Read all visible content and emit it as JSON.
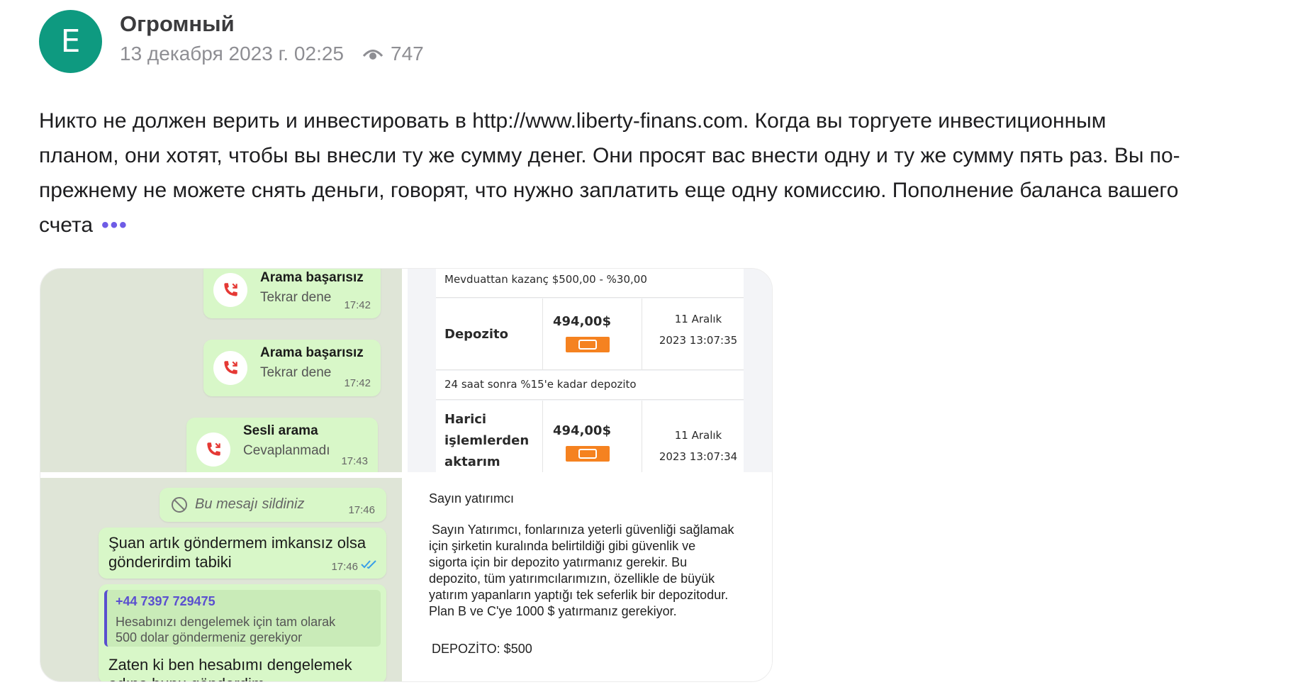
{
  "author": {
    "avatar_letter": "E",
    "avatar_color": "#0e9a80",
    "name": "Огромный"
  },
  "meta": {
    "date": "13 декабря 2023 г. 02:25",
    "views": "747",
    "views_icon": "eye-icon"
  },
  "post": {
    "text": "Никто не должен верить и инвестировать в http://www.liberty-finans.com. Когда вы торгуете инвестиционным планом, они хотят, чтобы вы внесли ту же сумму денег. Они просят вас внести одну и ту же сумму пять раз. Вы по-прежнему не можете снять деньги, говорят, что нужно заплатить еще одну комиссию. Пополнение баланса вашего счета",
    "more": "•••",
    "accent": "#6e5ce6"
  },
  "gallery": {
    "calls": [
      {
        "title": "Arama başarısız",
        "subtitle": "Tekrar dene",
        "time": "17:42"
      },
      {
        "title": "Arama başarısız",
        "subtitle": "Tekrar dene",
        "time": "17:42"
      },
      {
        "title": "Sesli arama",
        "subtitle": "Cevaplanmadı",
        "time": "17:43"
      }
    ],
    "deposits": {
      "header": "Mevduattan kazanç $500,00 - %30,00",
      "row1": {
        "label": "Depozito",
        "amount": "494,00$",
        "date1": "11 Aralık",
        "date2": "2023 13:07:35"
      },
      "note": "24 saat sonra %15'e kadar depozito",
      "row2": {
        "label1": "Harici",
        "label2": "işlemlerden",
        "label3": "aktarım",
        "amount": "494,00$",
        "date1": "11 Aralık",
        "date2": "2023 13:07:34"
      },
      "badge_color": "#f58220"
    },
    "chat": {
      "deleted": "Bu mesajı sildiniz",
      "deleted_time": "17:46",
      "msg1_line1": "Şuan artık göndermem imkansız olsa",
      "msg1_line2": "gönderirdim tabiki",
      "msg1_time": "17:46",
      "quote_phone": "+44 7397 729475",
      "quote_line1": "Hesabınızı dengelemek için tam olarak",
      "quote_line2": "500 dolar göndermeniz gerekiyor",
      "msg2_line1": "Zaten ki ben hesabımı  dengelemek",
      "msg2_line2": "adına bunu gönderdim"
    },
    "letter": {
      "greeting": "Sayın yatırımcı",
      "lines": [
        "Sayın Yatırımcı, fonlarınıza yeterli güvenliği sağlamak",
        "için şirketin kuralında belirtildiği gibi güvenlik ve",
        "sigorta için bir depozito yatırmanız gerekir. Bu",
        "depozito, tüm yatırımcılarımızın, özellikle de büyük",
        "yatırım yapanların yaptığı tek seferlik bir depozitodur.",
        "Plan B ve C'ye 1000 $ yatırmanız gerekiyor."
      ],
      "footer": "DEPOZİTO: $500"
    }
  }
}
